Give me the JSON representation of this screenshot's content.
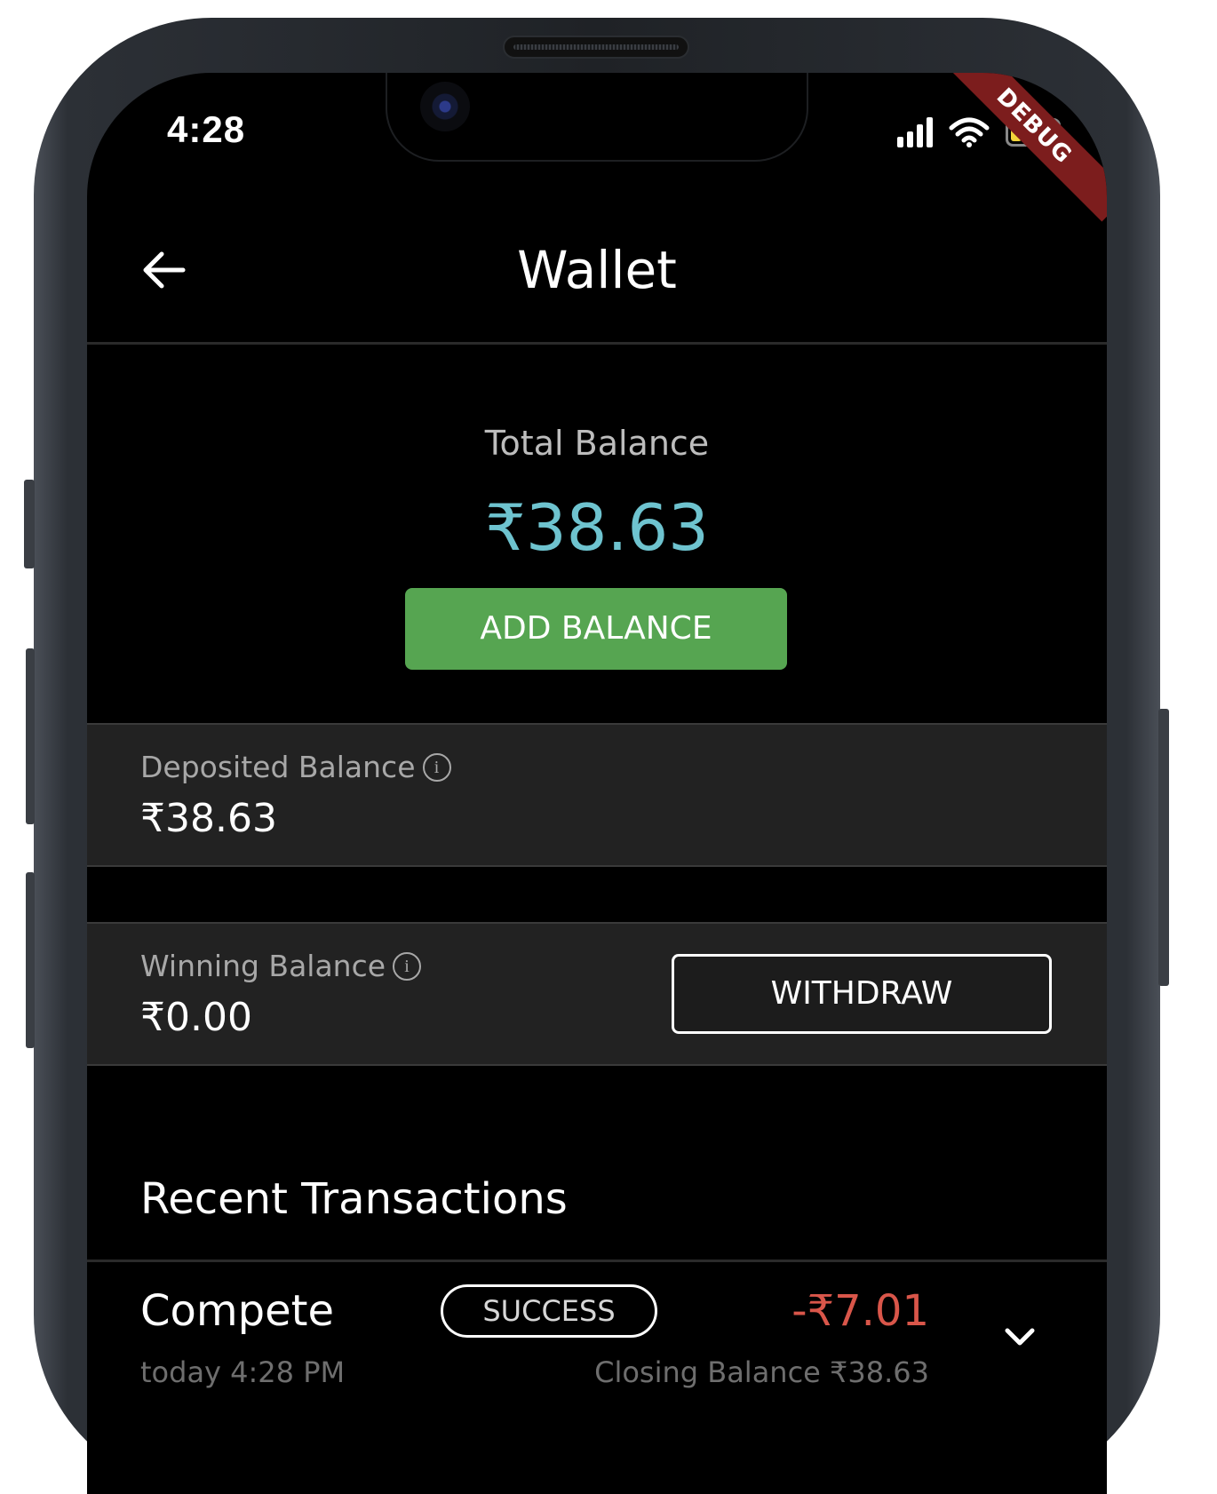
{
  "status_bar": {
    "time": "4:28",
    "debug_label": "DEBUG"
  },
  "appbar": {
    "title": "Wallet"
  },
  "total": {
    "label": "Total Balance",
    "value": "₹38.63",
    "color": "#6ec3cf"
  },
  "add_balance": {
    "label": "ADD BALANCE",
    "color": "#56a551"
  },
  "deposited": {
    "label": "Deposited Balance",
    "value": "₹38.63"
  },
  "winning": {
    "label": "Winning Balance",
    "value": "₹0.00",
    "withdraw_label": "WITHDRAW"
  },
  "recent": {
    "title": "Recent Transactions",
    "transactions": [
      {
        "title": "Compete",
        "status": "SUCCESS",
        "amount": "-₹7.01",
        "amount_color": "#d9564a",
        "date": "today 4:28 PM",
        "closing": "Closing Balance ₹38.63"
      }
    ]
  }
}
